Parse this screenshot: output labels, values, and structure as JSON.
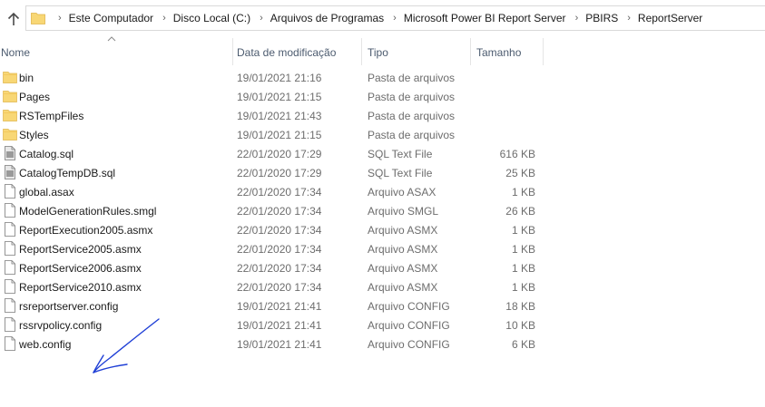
{
  "breadcrumb": [
    "Este Computador",
    "Disco Local (C:)",
    "Arquivos de Programas",
    "Microsoft Power BI Report Server",
    "PBIRS",
    "ReportServer"
  ],
  "columns": {
    "name": "Nome",
    "modified": "Data de modificação",
    "type": "Tipo",
    "size": "Tamanho"
  },
  "icons": {
    "up": "up-arrow-icon",
    "folder": "folder-icon",
    "sql": "sql-file-icon",
    "file": "file-icon"
  },
  "colors": {
    "folder": "#f8d775",
    "annotation": "#1f3fd6"
  },
  "files": [
    {
      "name": "bin",
      "modified": "19/01/2021 21:16",
      "type": "Pasta de arquivos",
      "size": "",
      "icon": "folder"
    },
    {
      "name": "Pages",
      "modified": "19/01/2021 21:15",
      "type": "Pasta de arquivos",
      "size": "",
      "icon": "folder"
    },
    {
      "name": "RSTempFiles",
      "modified": "19/01/2021 21:43",
      "type": "Pasta de arquivos",
      "size": "",
      "icon": "folder"
    },
    {
      "name": "Styles",
      "modified": "19/01/2021 21:15",
      "type": "Pasta de arquivos",
      "size": "",
      "icon": "folder"
    },
    {
      "name": "Catalog.sql",
      "modified": "22/01/2020 17:29",
      "type": "SQL Text File",
      "size": "616 KB",
      "icon": "sql"
    },
    {
      "name": "CatalogTempDB.sql",
      "modified": "22/01/2020 17:29",
      "type": "SQL Text File",
      "size": "25 KB",
      "icon": "sql"
    },
    {
      "name": "global.asax",
      "modified": "22/01/2020 17:34",
      "type": "Arquivo ASAX",
      "size": "1 KB",
      "icon": "file"
    },
    {
      "name": "ModelGenerationRules.smgl",
      "modified": "22/01/2020 17:34",
      "type": "Arquivo SMGL",
      "size": "26 KB",
      "icon": "file"
    },
    {
      "name": "ReportExecution2005.asmx",
      "modified": "22/01/2020 17:34",
      "type": "Arquivo ASMX",
      "size": "1 KB",
      "icon": "file"
    },
    {
      "name": "ReportService2005.asmx",
      "modified": "22/01/2020 17:34",
      "type": "Arquivo ASMX",
      "size": "1 KB",
      "icon": "file"
    },
    {
      "name": "ReportService2006.asmx",
      "modified": "22/01/2020 17:34",
      "type": "Arquivo ASMX",
      "size": "1 KB",
      "icon": "file"
    },
    {
      "name": "ReportService2010.asmx",
      "modified": "22/01/2020 17:34",
      "type": "Arquivo ASMX",
      "size": "1 KB",
      "icon": "file"
    },
    {
      "name": "rsreportserver.config",
      "modified": "19/01/2021 21:41",
      "type": "Arquivo CONFIG",
      "size": "18 KB",
      "icon": "file"
    },
    {
      "name": "rssrvpolicy.config",
      "modified": "19/01/2021 21:41",
      "type": "Arquivo CONFIG",
      "size": "10 KB",
      "icon": "file"
    },
    {
      "name": "web.config",
      "modified": "19/01/2021 21:41",
      "type": "Arquivo CONFIG",
      "size": "6 KB",
      "icon": "file"
    }
  ]
}
